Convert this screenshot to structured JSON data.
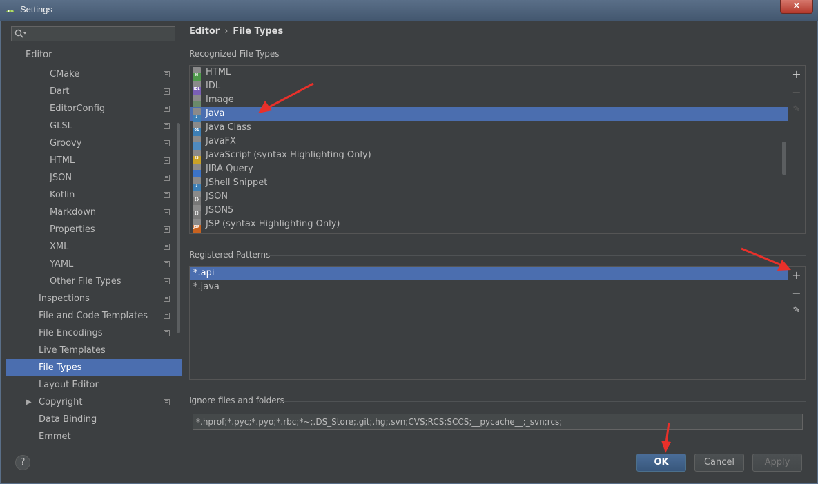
{
  "window": {
    "title": "Settings",
    "close_label": "✕"
  },
  "sidebar": {
    "search_placeholder": "",
    "section_label": "Editor",
    "items": [
      {
        "label": "CMake",
        "indent": 2,
        "project": true
      },
      {
        "label": "Dart",
        "indent": 2,
        "project": true
      },
      {
        "label": "EditorConfig",
        "indent": 2,
        "project": true
      },
      {
        "label": "GLSL",
        "indent": 2,
        "project": true
      },
      {
        "label": "Groovy",
        "indent": 2,
        "project": true
      },
      {
        "label": "HTML",
        "indent": 2,
        "project": true
      },
      {
        "label": "JSON",
        "indent": 2,
        "project": true
      },
      {
        "label": "Kotlin",
        "indent": 2,
        "project": true
      },
      {
        "label": "Markdown",
        "indent": 2,
        "project": true
      },
      {
        "label": "Properties",
        "indent": 2,
        "project": true
      },
      {
        "label": "XML",
        "indent": 2,
        "project": true
      },
      {
        "label": "YAML",
        "indent": 2,
        "project": true
      },
      {
        "label": "Other File Types",
        "indent": 2,
        "project": true
      },
      {
        "label": "Inspections",
        "indent": 1,
        "project": true
      },
      {
        "label": "File and Code Templates",
        "indent": 1,
        "project": true
      },
      {
        "label": "File Encodings",
        "indent": 1,
        "project": true
      },
      {
        "label": "Live Templates",
        "indent": 1,
        "project": false
      },
      {
        "label": "File Types",
        "indent": 1,
        "project": false,
        "selected": true
      },
      {
        "label": "Layout Editor",
        "indent": 1,
        "project": false
      },
      {
        "label": "Copyright",
        "indent": 1,
        "project": true,
        "expandable": true
      },
      {
        "label": "Data Binding",
        "indent": 1,
        "project": false
      },
      {
        "label": "Emmet",
        "indent": 1,
        "project": false
      }
    ]
  },
  "breadcrumb": {
    "parent": "Editor",
    "separator": "›",
    "current": "File Types"
  },
  "recognized": {
    "heading": "Recognized File Types",
    "items": [
      {
        "label": "HTML",
        "icon": "html-file-icon",
        "color": "#4e9a4a",
        "tag": "H"
      },
      {
        "label": "IDL",
        "icon": "idl-file-icon",
        "color": "#7a5fb5",
        "tag": "IDL"
      },
      {
        "label": "Image",
        "icon": "image-file-icon",
        "color": "#6a8a6a",
        "tag": ""
      },
      {
        "label": "Java",
        "icon": "java-file-icon",
        "color": "#3d7fb5",
        "tag": "J",
        "selected": true
      },
      {
        "label": "Java Class",
        "icon": "java-class-file-icon",
        "color": "#3d7fb5",
        "tag": "01"
      },
      {
        "label": "JavaFX",
        "icon": "javafx-file-icon",
        "color": "#4e8abf",
        "tag": ""
      },
      {
        "label": "JavaScript (syntax Highlighting Only)",
        "icon": "javascript-file-icon",
        "color": "#c9a227",
        "tag": "JS"
      },
      {
        "label": "JIRA Query",
        "icon": "jira-icon",
        "color": "#3b73c8",
        "tag": ""
      },
      {
        "label": "JShell Snippet",
        "icon": "jshell-file-icon",
        "color": "#3d7fb5",
        "tag": "J"
      },
      {
        "label": "JSON",
        "icon": "json-file-icon",
        "color": "#777777",
        "tag": "{}"
      },
      {
        "label": "JSON5",
        "icon": "json5-file-icon",
        "color": "#777777",
        "tag": "{}"
      },
      {
        "label": "JSP (syntax Highlighting Only)",
        "icon": "jsp-file-icon",
        "color": "#c8621f",
        "tag": "JSP"
      }
    ]
  },
  "patterns": {
    "heading": "Registered Patterns",
    "items": [
      {
        "label": "*.api",
        "selected": true
      },
      {
        "label": "*.java"
      }
    ]
  },
  "ignore": {
    "heading": "Ignore files and folders",
    "value": "*.hprof;*.pyc;*.pyo;*.rbc;*~;.DS_Store;.git;.hg;.svn;CVS;RCS;SCCS;__pycache__;_svn;rcs;"
  },
  "buttons": {
    "ok": "OK",
    "cancel": "Cancel",
    "apply": "Apply",
    "help": "?"
  },
  "tools": {
    "add": "+",
    "remove": "−",
    "edit": "✎"
  },
  "colors": {
    "accent": "#4b6eaf",
    "annotation": "#e8302a"
  }
}
